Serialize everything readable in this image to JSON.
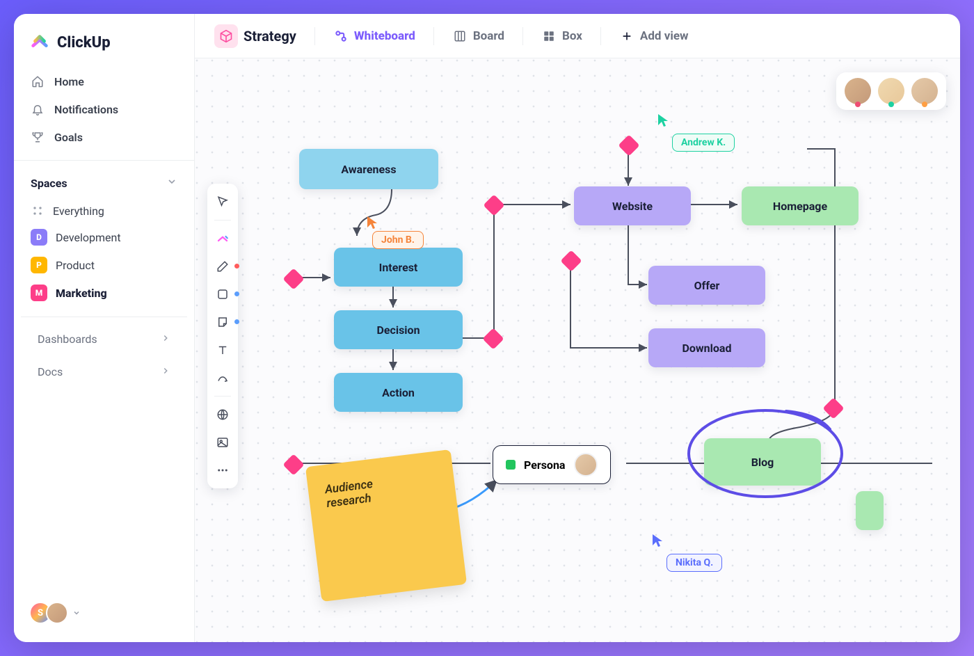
{
  "brand": "ClickUp",
  "nav": {
    "home": "Home",
    "notifications": "Notifications",
    "goals": "Goals"
  },
  "sidebar": {
    "spaces_title": "Spaces",
    "everything": "Everything",
    "spaces": [
      {
        "initial": "D",
        "label": "Development",
        "color": "#8b7cf8"
      },
      {
        "initial": "P",
        "label": "Product",
        "color": "#ffb700"
      },
      {
        "initial": "M",
        "label": "Marketing",
        "color": "#fd3e88"
      }
    ],
    "dashboards": "Dashboards",
    "docs": "Docs",
    "user_initial": "S"
  },
  "topbar": {
    "space": "Strategy",
    "tabs": {
      "whiteboard": "Whiteboard",
      "board": "Board",
      "box": "Box",
      "add": "Add view"
    }
  },
  "nodes": {
    "awareness": "Awareness",
    "interest": "Interest",
    "decision": "Decision",
    "action": "Action",
    "website": "Website",
    "offer": "Offer",
    "download": "Download",
    "homepage": "Homepage",
    "blog": "Blog",
    "persona": "Persona"
  },
  "sticky": {
    "line1": "Audience",
    "line2": "research"
  },
  "cursors": {
    "john": "John B.",
    "andrew": "Andrew K.",
    "nikita": "Nikita Q."
  },
  "toolbar_dots": {
    "pen": "#ff5c5c",
    "shape": "#5b9dfc",
    "note": "#5b9dfc"
  }
}
